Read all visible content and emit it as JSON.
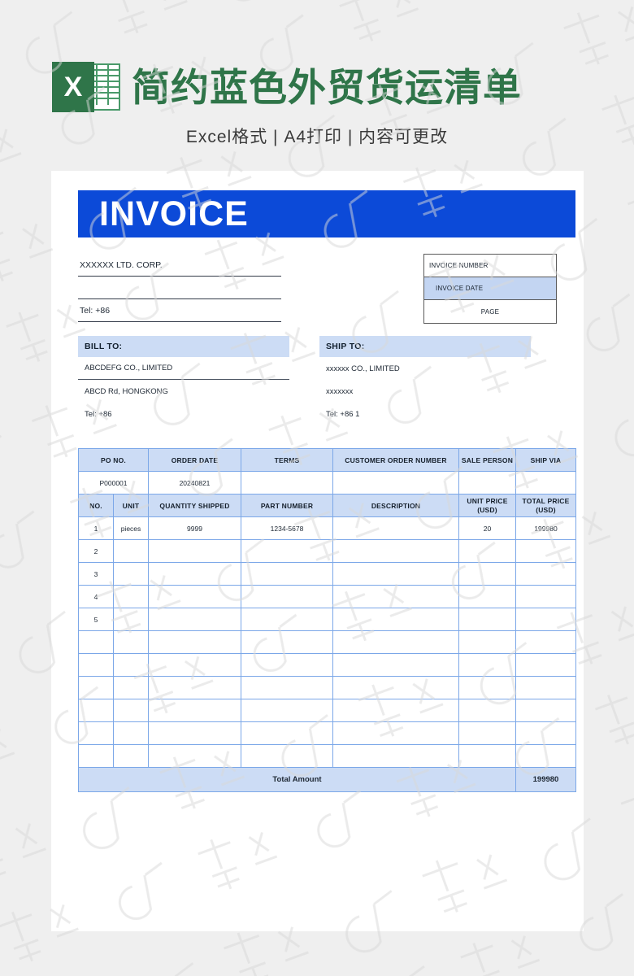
{
  "promo": {
    "icon": "excel-file-icon",
    "icon_letter": "X",
    "title": "简约蓝色外贸货运清单",
    "subtitle": "Excel格式 | A4打印 | 内容可更改",
    "accent_color": "#2f7549"
  },
  "document": {
    "banner_title": "INVOICE",
    "banner_color": "#0c4ad8",
    "seller": {
      "name": "XXXXXX LTD. CORP.",
      "address": "",
      "tel": "Tel: +86"
    },
    "meta": {
      "invoice_number_label": "INVOICE NUMBER",
      "invoice_date_label": "INVOICE DATE",
      "page_label": "PAGE",
      "highlight_color": "#c3d5f2"
    },
    "bill_to": {
      "title": "BILL TO:",
      "company": "ABCDEFG CO., LIMITED",
      "address": "ABCD Rd, HONGKONG",
      "tel": "Tel: +86"
    },
    "ship_to": {
      "title": "SHIP TO:",
      "company": "xxxxxx CO., LIMITED",
      "address": "xxxxxxx",
      "tel": "Tel: +86  1"
    },
    "order_table": {
      "headers": [
        "PO NO.",
        "ORDER DATE",
        "TERMS",
        "CUSTOMER ORDER NUMBER",
        "SALE PERSON",
        "SHIP VIA"
      ],
      "values": [
        "P000001",
        "20240821",
        "",
        "",
        "",
        ""
      ]
    },
    "items_table": {
      "headers": [
        "NO.",
        "UNIT",
        "QUANTITY SHIPPED",
        "PART NUMBER",
        "DESCRIPTION",
        "UNIT PRICE\n(USD)",
        "TOTAL PRICE\n(USD)"
      ],
      "header_unit_price_line1": "UNIT PRICE",
      "header_unit_price_line2": "(USD)",
      "header_total_price_line1": "TOTAL PRICE",
      "header_total_price_line2": "(USD)",
      "rows": [
        {
          "no": "1",
          "unit": "pieces",
          "qty": "9999",
          "part": "1234-5678",
          "desc": "",
          "unit_price": "20",
          "total_price": "199980"
        },
        {
          "no": "2",
          "unit": "",
          "qty": "",
          "part": "",
          "desc": "",
          "unit_price": "",
          "total_price": ""
        },
        {
          "no": "3",
          "unit": "",
          "qty": "",
          "part": "",
          "desc": "",
          "unit_price": "",
          "total_price": ""
        },
        {
          "no": "4",
          "unit": "",
          "qty": "",
          "part": "",
          "desc": "",
          "unit_price": "",
          "total_price": ""
        },
        {
          "no": "5",
          "unit": "",
          "qty": "",
          "part": "",
          "desc": "",
          "unit_price": "",
          "total_price": ""
        },
        {
          "no": "",
          "unit": "",
          "qty": "",
          "part": "",
          "desc": "",
          "unit_price": "",
          "total_price": ""
        },
        {
          "no": "",
          "unit": "",
          "qty": "",
          "part": "",
          "desc": "",
          "unit_price": "",
          "total_price": ""
        },
        {
          "no": "",
          "unit": "",
          "qty": "",
          "part": "",
          "desc": "",
          "unit_price": "",
          "total_price": ""
        },
        {
          "no": "",
          "unit": "",
          "qty": "",
          "part": "",
          "desc": "",
          "unit_price": "",
          "total_price": ""
        },
        {
          "no": "",
          "unit": "",
          "qty": "",
          "part": "",
          "desc": "",
          "unit_price": "",
          "total_price": ""
        },
        {
          "no": "",
          "unit": "",
          "qty": "",
          "part": "",
          "desc": "",
          "unit_price": "",
          "total_price": ""
        }
      ],
      "total_label": "Total Amount",
      "total_value": "199980",
      "header_fill": "#ccdcf5",
      "border_color": "#7ba7e8"
    }
  }
}
